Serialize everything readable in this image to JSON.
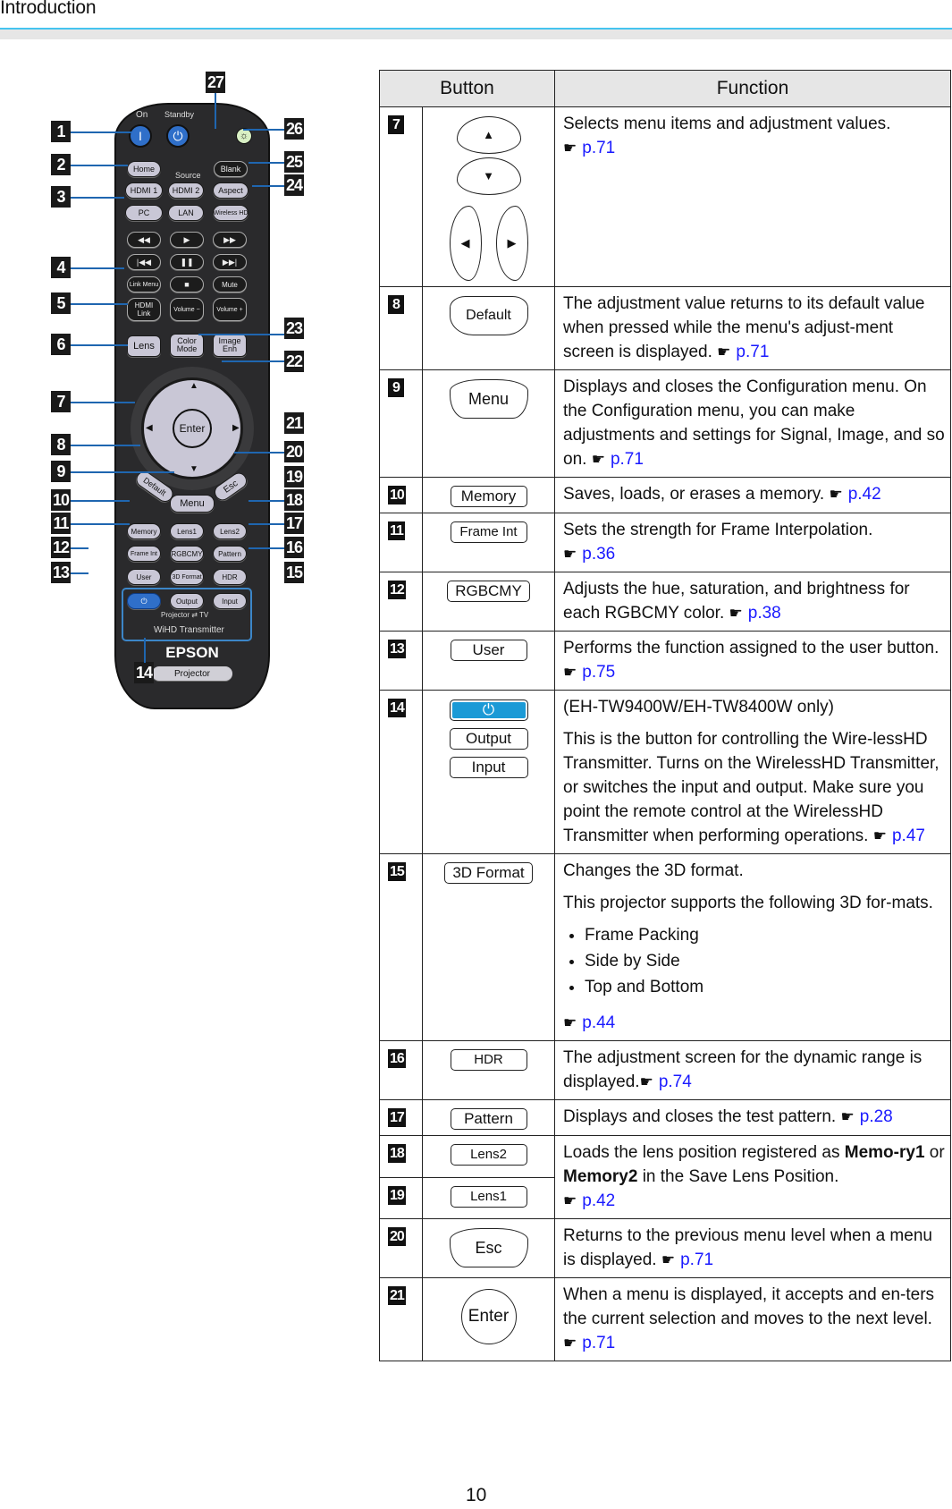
{
  "header": {
    "title": "Introduction"
  },
  "remote": {
    "labels": {
      "on": "On",
      "standby": "Standby",
      "source": "Source",
      "home": "Home",
      "blank": "Blank",
      "hdmi1": "HDMI 1",
      "hdmi2": "HDMI 2",
      "aspect": "Aspect",
      "pc": "PC",
      "lan": "LAN",
      "wireless_hd": "Wireless HD",
      "rewind": "◀◀",
      "play": "▶",
      "fast_forward": "▶▶",
      "prev": "|◀◀",
      "pause": "❚❚",
      "next": "▶▶|",
      "link_menu": "Link Menu",
      "stop": "■",
      "mute": "Mute",
      "hdmi_link": "HDMI Link",
      "volume_minus": "Volume −",
      "volume_plus": "Volume +",
      "lens": "Lens",
      "color_mode": "Color Mode",
      "image_enh": "Image Enh",
      "enter": "Enter",
      "default": "Default",
      "menu": "Menu",
      "esc": "Esc",
      "memory": "Memory",
      "lens1": "Lens1",
      "lens2": "Lens2",
      "frame_int": "Frame Int",
      "rgbcmy": "RGBCMY",
      "pattern": "Pattern",
      "user": "User",
      "format3d": "3D Format",
      "hdr": "HDR",
      "output": "Output",
      "input": "Input",
      "projector_tv": "Projector ⇄ TV",
      "wihd_transmitter": "WiHD Transmitter",
      "brand": "EPSON",
      "product": "Projector"
    },
    "callouts": [
      "1",
      "2",
      "3",
      "4",
      "5",
      "6",
      "7",
      "8",
      "9",
      "10",
      "11",
      "12",
      "13",
      "14",
      "15",
      "16",
      "17",
      "18",
      "19",
      "20",
      "21",
      "22",
      "23",
      "24",
      "25",
      "26",
      "27"
    ]
  },
  "table": {
    "headers": {
      "button": "Button",
      "function": "Function"
    },
    "ref_icon": "☛",
    "rows": [
      {
        "num": "7",
        "keys": [
          "▲",
          "▼",
          "◀",
          "▶"
        ],
        "text": "Selects menu items and adjustment values.",
        "ref": "p.71"
      },
      {
        "num": "8",
        "keys": [
          "Default"
        ],
        "text": "The adjustment value returns to its default value when pressed while the menu's adjust-ment screen is displayed.",
        "ref": "p.71"
      },
      {
        "num": "9",
        "keys": [
          "Menu"
        ],
        "text": "Displays and closes the Configuration menu. On the Configuration menu, you can make adjustments and settings for Signal, Image, and so on.",
        "ref": "p.71"
      },
      {
        "num": "10",
        "keys": [
          "Memory"
        ],
        "text": "Saves, loads, or erases a memory.",
        "ref": "p.42"
      },
      {
        "num": "11",
        "keys": [
          "Frame Int"
        ],
        "text": "Sets the strength for Frame Interpolation.",
        "ref": "p.36"
      },
      {
        "num": "12",
        "keys": [
          "RGBCMY"
        ],
        "text": "Adjusts the hue, saturation, and brightness for each RGBCMY color.",
        "ref": "p.38"
      },
      {
        "num": "13",
        "keys": [
          "User"
        ],
        "text": "Performs the function assigned to the user button.",
        "ref": "p.75"
      },
      {
        "num": "14",
        "keys": [
          "⏻",
          "Output",
          "Input"
        ],
        "note": "(EH-TW9400W/EH-TW8400W only)",
        "text": "This is the button for controlling the Wire-lessHD Transmitter. Turns on the WirelessHD Transmitter, or switches the input and output. Make sure you point the remote control at the WirelessHD Transmitter when performing operations.",
        "ref": "p.47"
      },
      {
        "num": "15",
        "keys": [
          "3D Format"
        ],
        "text": "Changes the 3D format.",
        "text2": "This projector supports the following 3D for-mats.",
        "list": [
          "Frame Packing",
          "Side by Side",
          "Top and Bottom"
        ],
        "ref": "p.44"
      },
      {
        "num": "16",
        "keys": [
          "HDR"
        ],
        "text": "The adjustment screen for the dynamic range is displayed.",
        "ref": "p.74"
      },
      {
        "num": "17",
        "keys": [
          "Pattern"
        ],
        "text": "Displays and closes the test pattern.",
        "ref": "p.28"
      },
      {
        "num": "18",
        "keys": [
          "Lens2"
        ],
        "text_pre": "Loads the lens position registered as ",
        "bold1": "Memo-ry1",
        "text_mid": " or ",
        "bold2": "Memory2",
        "text_post": " in the Save Lens Position.",
        "ref": "p.42"
      },
      {
        "num": "19",
        "keys": [
          "Lens1"
        ]
      },
      {
        "num": "20",
        "keys": [
          "Esc"
        ],
        "text": "Returns to the previous menu level when a menu is displayed.",
        "ref": "p.71"
      },
      {
        "num": "21",
        "keys": [
          "Enter"
        ],
        "text": "When a menu is displayed, it accepts and en-ters the current selection and moves to the next level.",
        "ref": "p.71"
      }
    ]
  },
  "footer": {
    "page_number": "10"
  },
  "colors": {
    "accent_rule": "#45c4ef",
    "header_band": "#e6e6e6",
    "link": "#1a1aff",
    "callout_line": "#1f66b0",
    "wihd_power": "#1b9ad6"
  }
}
